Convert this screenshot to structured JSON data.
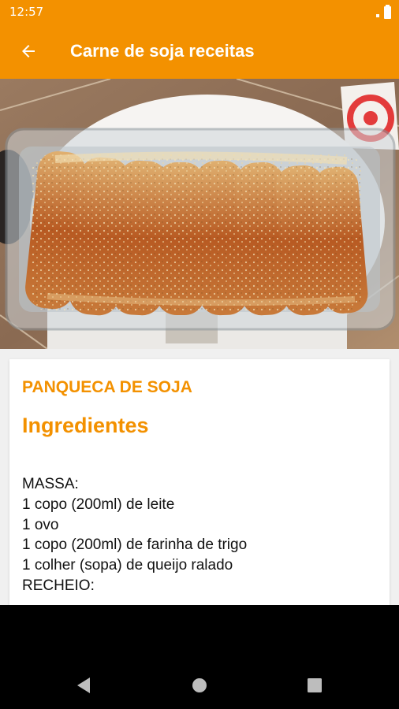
{
  "status_bar": {
    "time": "12:57",
    "icons": [
      "signal-icon",
      "battery-icon"
    ]
  },
  "app_bar": {
    "title": "Carne de soja receitas",
    "back_icon": "arrow-back-icon",
    "color": "#f39100"
  },
  "recipe": {
    "title": "PANQUECA DE SOJA",
    "section_heading": "Ingredientes",
    "ingredients": [
      "MASSA:",
      "1 copo (200ml) de leite",
      "1 ovo",
      "1 copo (200ml) de farinha de trigo",
      "1 colher (sopa) de queijo ralado",
      "RECHEIO:"
    ]
  },
  "nav_bar": {
    "icons": [
      "nav-back-icon",
      "nav-home-icon",
      "nav-recents-icon"
    ]
  }
}
